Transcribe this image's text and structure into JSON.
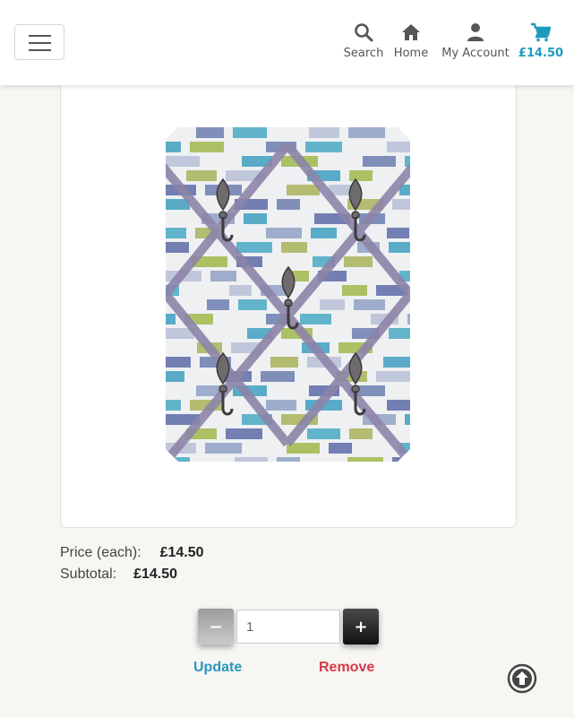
{
  "header": {
    "nav": {
      "search": {
        "label": "Search",
        "icon": "search-icon"
      },
      "home": {
        "label": "Home",
        "icon": "home-icon"
      },
      "account": {
        "label": "My Account",
        "icon": "user-icon"
      },
      "cart": {
        "label": "£14.50",
        "icon": "cart-icon"
      }
    },
    "menu_icon": "hamburger-icon"
  },
  "product": {
    "image_alt": "Notice board with ribbons and hooks"
  },
  "pricing": {
    "price_label": "Price (each):",
    "price_value": "£14.50",
    "subtotal_label": "Subtotal:",
    "subtotal_value": "£14.50"
  },
  "quantity": {
    "minus_label": "−",
    "plus_label": "+",
    "value": "1"
  },
  "actions": {
    "update_label": "Update",
    "remove_label": "Remove"
  },
  "colors": {
    "accent": "#1b9cbf",
    "remove": "#d53949"
  },
  "back_to_top_icon": "arrow-up-circle-icon"
}
